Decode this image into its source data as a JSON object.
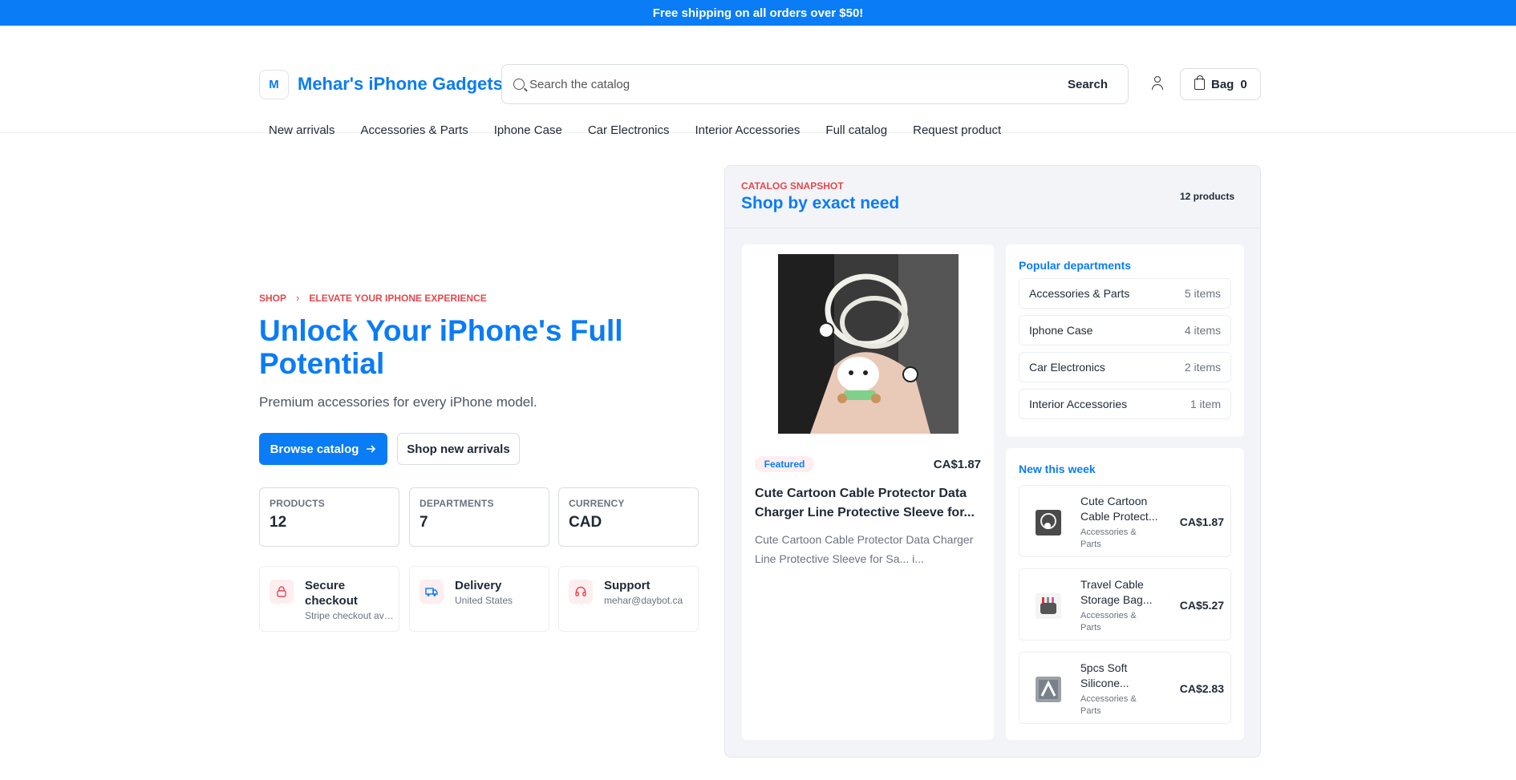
{
  "promo": {
    "text": "Free shipping on all orders over $50!"
  },
  "header": {
    "logo_letter": "M",
    "store_name": "Mehar's iPhone Gadgets",
    "search_placeholder": "Search the catalog",
    "search_button": "Search",
    "bag_label": "Bag",
    "bag_count": "0"
  },
  "nav": {
    "items": [
      "New arrivals",
      "Accessories & Parts",
      "Iphone Case",
      "Car Electronics",
      "Interior Accessories",
      "Full catalog",
      "Request product"
    ]
  },
  "hero": {
    "breadcrumb": [
      "SHOP",
      "ELEVATE YOUR IPHONE EXPERIENCE"
    ],
    "title": "Unlock Your iPhone's Full Potential",
    "subtitle": "Premium accessories for every iPhone model.",
    "primary_button": "Browse catalog",
    "secondary_button": "Shop new arrivals"
  },
  "stats": [
    {
      "label": "PRODUCTS",
      "value": "12"
    },
    {
      "label": "DEPARTMENTS",
      "value": "7"
    },
    {
      "label": "CURRENCY",
      "value": "CAD"
    }
  ],
  "features": [
    {
      "title": "Secure checkout",
      "sub": "Stripe checkout available",
      "icon": "lock-icon"
    },
    {
      "title": "Delivery",
      "sub": "United States",
      "icon": "truck-icon"
    },
    {
      "title": "Support",
      "sub": "mehar@daybot.ca",
      "icon": "headphones-icon"
    }
  ],
  "panel": {
    "eyebrow": "CATALOG SNAPSHOT",
    "title": "Shop by exact need",
    "count": "12 products",
    "featured": {
      "badge": "Featured",
      "price": "CA$1.87",
      "title": "Cute Cartoon Cable Protector Data Charger Line Protective Sleeve for...",
      "desc": "Cute Cartoon Cable Protector Data Charger Line Protective Sleeve for Sa... i..."
    },
    "departments_title": "Popular departments",
    "departments": [
      {
        "name": "Accessories & Parts",
        "count": "5 items"
      },
      {
        "name": "Iphone Case",
        "count": "4 items"
      },
      {
        "name": "Car Electronics",
        "count": "2 items"
      },
      {
        "name": "Interior Accessories",
        "count": "1 item"
      }
    ],
    "new_title": "New this week",
    "new_items": [
      {
        "name": "Cute Cartoon Cable Protect...",
        "category": "Accessories & Parts",
        "price": "CA$1.87"
      },
      {
        "name": "Travel Cable Storage Bag...",
        "category": "Accessories & Parts",
        "price": "CA$5.27"
      },
      {
        "name": "5pcs Soft Silicone...",
        "category": "Accessories & Parts",
        "price": "CA$2.83"
      }
    ]
  },
  "colors": {
    "brand": "#0a7cf5",
    "accent_red": "#e5484d"
  }
}
